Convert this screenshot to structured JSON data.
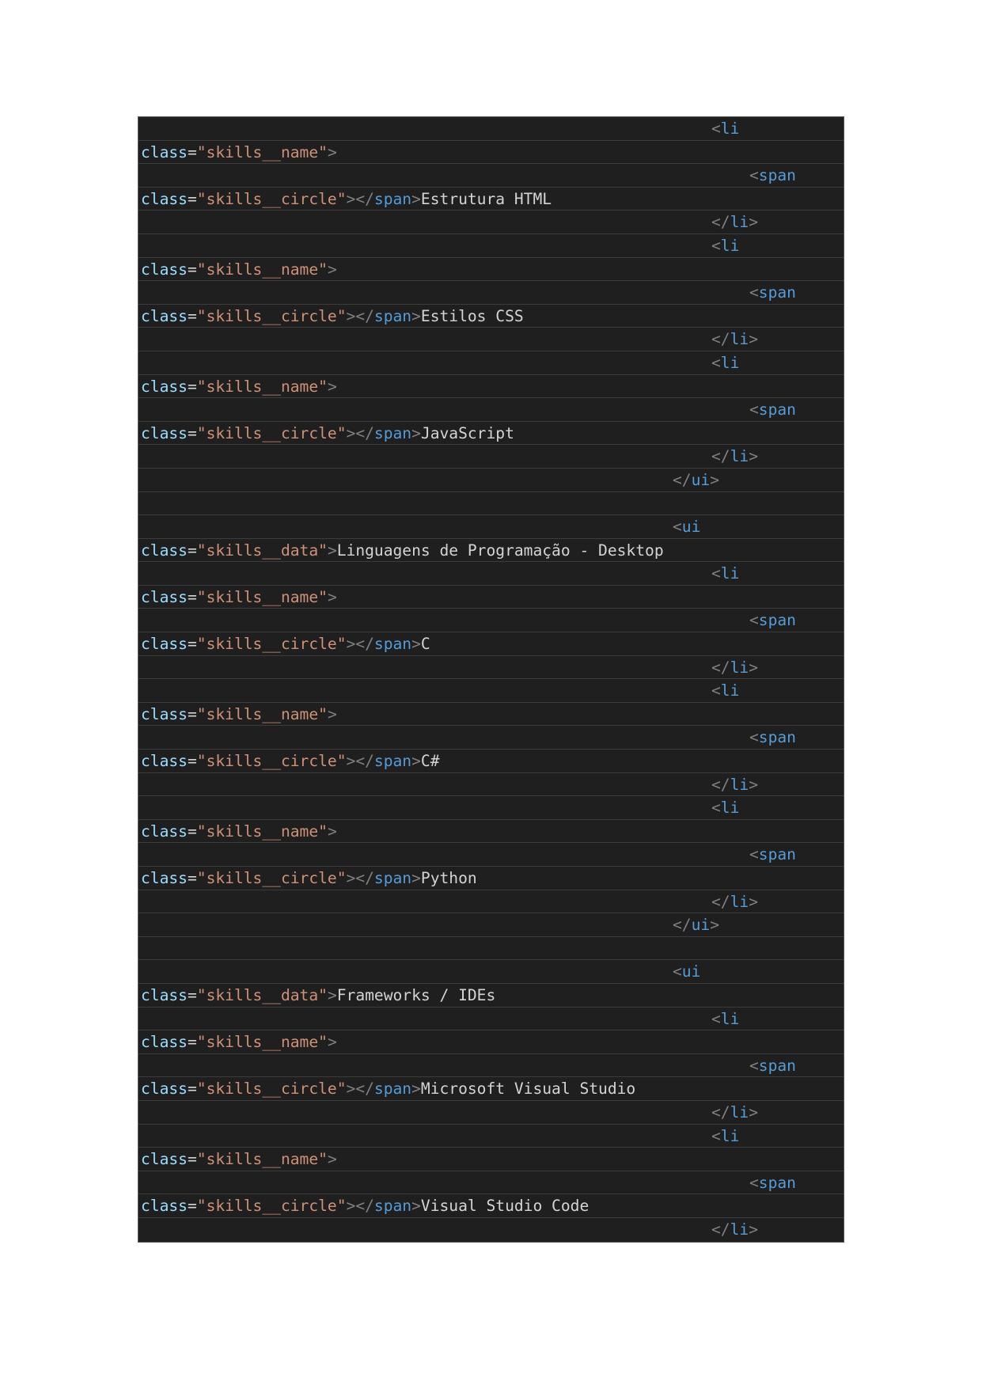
{
  "colors": {
    "background": "#1f1f1f",
    "attribute": "#9cdcfe",
    "string": "#ce9178",
    "punctuation": "#808080",
    "tag": "#569cd6",
    "text": "#d4d4d4"
  },
  "lines": [
    {
      "indent": "li",
      "tokens": [
        {
          "c": "punc",
          "t": "<"
        },
        {
          "c": "tag",
          "t": "li"
        }
      ]
    },
    {
      "indent": "none",
      "tokens": [
        {
          "c": "attr",
          "t": "class"
        },
        {
          "c": "eq",
          "t": "="
        },
        {
          "c": "str",
          "t": "\"skills__name\""
        },
        {
          "c": "punc",
          "t": ">"
        }
      ]
    },
    {
      "indent": "span",
      "tokens": [
        {
          "c": "punc",
          "t": "<"
        },
        {
          "c": "tag",
          "t": "span"
        }
      ]
    },
    {
      "indent": "none",
      "tokens": [
        {
          "c": "attr",
          "t": "class"
        },
        {
          "c": "eq",
          "t": "="
        },
        {
          "c": "str",
          "t": "\"skills__circle\""
        },
        {
          "c": "punc",
          "t": "></"
        },
        {
          "c": "tag",
          "t": "span"
        },
        {
          "c": "punc",
          "t": ">"
        },
        {
          "c": "text",
          "t": "Estrutura HTML"
        }
      ]
    },
    {
      "indent": "li",
      "tokens": [
        {
          "c": "punc",
          "t": "</"
        },
        {
          "c": "tag",
          "t": "li"
        },
        {
          "c": "punc",
          "t": ">"
        }
      ]
    },
    {
      "indent": "li",
      "tokens": [
        {
          "c": "punc",
          "t": "<"
        },
        {
          "c": "tag",
          "t": "li"
        }
      ]
    },
    {
      "indent": "none",
      "tokens": [
        {
          "c": "attr",
          "t": "class"
        },
        {
          "c": "eq",
          "t": "="
        },
        {
          "c": "str",
          "t": "\"skills__name\""
        },
        {
          "c": "punc",
          "t": ">"
        }
      ]
    },
    {
      "indent": "span",
      "tokens": [
        {
          "c": "punc",
          "t": "<"
        },
        {
          "c": "tag",
          "t": "span"
        }
      ]
    },
    {
      "indent": "none",
      "tokens": [
        {
          "c": "attr",
          "t": "class"
        },
        {
          "c": "eq",
          "t": "="
        },
        {
          "c": "str",
          "t": "\"skills__circle\""
        },
        {
          "c": "punc",
          "t": "></"
        },
        {
          "c": "tag",
          "t": "span"
        },
        {
          "c": "punc",
          "t": ">"
        },
        {
          "c": "text",
          "t": "Estilos CSS"
        }
      ]
    },
    {
      "indent": "li",
      "tokens": [
        {
          "c": "punc",
          "t": "</"
        },
        {
          "c": "tag",
          "t": "li"
        },
        {
          "c": "punc",
          "t": ">"
        }
      ]
    },
    {
      "indent": "li",
      "tokens": [
        {
          "c": "punc",
          "t": "<"
        },
        {
          "c": "tag",
          "t": "li"
        }
      ]
    },
    {
      "indent": "none",
      "tokens": [
        {
          "c": "attr",
          "t": "class"
        },
        {
          "c": "eq",
          "t": "="
        },
        {
          "c": "str",
          "t": "\"skills__name\""
        },
        {
          "c": "punc",
          "t": ">"
        }
      ]
    },
    {
      "indent": "span",
      "tokens": [
        {
          "c": "punc",
          "t": "<"
        },
        {
          "c": "tag",
          "t": "span"
        }
      ]
    },
    {
      "indent": "none",
      "tokens": [
        {
          "c": "attr",
          "t": "class"
        },
        {
          "c": "eq",
          "t": "="
        },
        {
          "c": "str",
          "t": "\"skills__circle\""
        },
        {
          "c": "punc",
          "t": "></"
        },
        {
          "c": "tag",
          "t": "span"
        },
        {
          "c": "punc",
          "t": ">"
        },
        {
          "c": "text",
          "t": "JavaScript"
        }
      ]
    },
    {
      "indent": "li",
      "tokens": [
        {
          "c": "punc",
          "t": "</"
        },
        {
          "c": "tag",
          "t": "li"
        },
        {
          "c": "punc",
          "t": ">"
        }
      ]
    },
    {
      "indent": "ui",
      "tokens": [
        {
          "c": "punc",
          "t": "</"
        },
        {
          "c": "tag",
          "t": "ui"
        },
        {
          "c": "punc",
          "t": ">"
        }
      ]
    },
    {
      "indent": "none",
      "tokens": []
    },
    {
      "indent": "ui",
      "tokens": [
        {
          "c": "punc",
          "t": "<"
        },
        {
          "c": "tag",
          "t": "ui"
        }
      ]
    },
    {
      "indent": "none",
      "tokens": [
        {
          "c": "attr",
          "t": "class"
        },
        {
          "c": "eq",
          "t": "="
        },
        {
          "c": "str",
          "t": "\"skills__data\""
        },
        {
          "c": "punc",
          "t": ">"
        },
        {
          "c": "text",
          "t": "Linguagens de Programação - Desktop"
        }
      ]
    },
    {
      "indent": "li",
      "tokens": [
        {
          "c": "punc",
          "t": "<"
        },
        {
          "c": "tag",
          "t": "li"
        }
      ]
    },
    {
      "indent": "none",
      "tokens": [
        {
          "c": "attr",
          "t": "class"
        },
        {
          "c": "eq",
          "t": "="
        },
        {
          "c": "str",
          "t": "\"skills__name\""
        },
        {
          "c": "punc",
          "t": ">"
        }
      ]
    },
    {
      "indent": "span",
      "tokens": [
        {
          "c": "punc",
          "t": "<"
        },
        {
          "c": "tag",
          "t": "span"
        }
      ]
    },
    {
      "indent": "none",
      "tokens": [
        {
          "c": "attr",
          "t": "class"
        },
        {
          "c": "eq",
          "t": "="
        },
        {
          "c": "str",
          "t": "\"skills__circle\""
        },
        {
          "c": "punc",
          "t": "></"
        },
        {
          "c": "tag",
          "t": "span"
        },
        {
          "c": "punc",
          "t": ">"
        },
        {
          "c": "text",
          "t": "C"
        }
      ]
    },
    {
      "indent": "li",
      "tokens": [
        {
          "c": "punc",
          "t": "</"
        },
        {
          "c": "tag",
          "t": "li"
        },
        {
          "c": "punc",
          "t": ">"
        }
      ]
    },
    {
      "indent": "li",
      "tokens": [
        {
          "c": "punc",
          "t": "<"
        },
        {
          "c": "tag",
          "t": "li"
        }
      ]
    },
    {
      "indent": "none",
      "tokens": [
        {
          "c": "attr",
          "t": "class"
        },
        {
          "c": "eq",
          "t": "="
        },
        {
          "c": "str",
          "t": "\"skills__name\""
        },
        {
          "c": "punc",
          "t": ">"
        }
      ]
    },
    {
      "indent": "span",
      "tokens": [
        {
          "c": "punc",
          "t": "<"
        },
        {
          "c": "tag",
          "t": "span"
        }
      ]
    },
    {
      "indent": "none",
      "tokens": [
        {
          "c": "attr",
          "t": "class"
        },
        {
          "c": "eq",
          "t": "="
        },
        {
          "c": "str",
          "t": "\"skills__circle\""
        },
        {
          "c": "punc",
          "t": "></"
        },
        {
          "c": "tag",
          "t": "span"
        },
        {
          "c": "punc",
          "t": ">"
        },
        {
          "c": "text",
          "t": "C#"
        }
      ]
    },
    {
      "indent": "li",
      "tokens": [
        {
          "c": "punc",
          "t": "</"
        },
        {
          "c": "tag",
          "t": "li"
        },
        {
          "c": "punc",
          "t": ">"
        }
      ]
    },
    {
      "indent": "li",
      "tokens": [
        {
          "c": "punc",
          "t": "<"
        },
        {
          "c": "tag",
          "t": "li"
        }
      ]
    },
    {
      "indent": "none",
      "tokens": [
        {
          "c": "attr",
          "t": "class"
        },
        {
          "c": "eq",
          "t": "="
        },
        {
          "c": "str",
          "t": "\"skills__name\""
        },
        {
          "c": "punc",
          "t": ">"
        }
      ]
    },
    {
      "indent": "span",
      "tokens": [
        {
          "c": "punc",
          "t": "<"
        },
        {
          "c": "tag",
          "t": "span"
        }
      ]
    },
    {
      "indent": "none",
      "tokens": [
        {
          "c": "attr",
          "t": "class"
        },
        {
          "c": "eq",
          "t": "="
        },
        {
          "c": "str",
          "t": "\"skills__circle\""
        },
        {
          "c": "punc",
          "t": "></"
        },
        {
          "c": "tag",
          "t": "span"
        },
        {
          "c": "punc",
          "t": ">"
        },
        {
          "c": "text",
          "t": "Python"
        }
      ]
    },
    {
      "indent": "li",
      "tokens": [
        {
          "c": "punc",
          "t": "</"
        },
        {
          "c": "tag",
          "t": "li"
        },
        {
          "c": "punc",
          "t": ">"
        }
      ]
    },
    {
      "indent": "ui",
      "tokens": [
        {
          "c": "punc",
          "t": "</"
        },
        {
          "c": "tag",
          "t": "ui"
        },
        {
          "c": "punc",
          "t": ">"
        }
      ]
    },
    {
      "indent": "none",
      "tokens": []
    },
    {
      "indent": "ui",
      "tokens": [
        {
          "c": "punc",
          "t": "<"
        },
        {
          "c": "tag",
          "t": "ui"
        }
      ]
    },
    {
      "indent": "none",
      "tokens": [
        {
          "c": "attr",
          "t": "class"
        },
        {
          "c": "eq",
          "t": "="
        },
        {
          "c": "str",
          "t": "\"skills__data\""
        },
        {
          "c": "punc",
          "t": ">"
        },
        {
          "c": "text",
          "t": "Frameworks / IDEs"
        }
      ]
    },
    {
      "indent": "li",
      "tokens": [
        {
          "c": "punc",
          "t": "<"
        },
        {
          "c": "tag",
          "t": "li"
        }
      ]
    },
    {
      "indent": "none",
      "tokens": [
        {
          "c": "attr",
          "t": "class"
        },
        {
          "c": "eq",
          "t": "="
        },
        {
          "c": "str",
          "t": "\"skills__name\""
        },
        {
          "c": "punc",
          "t": ">"
        }
      ]
    },
    {
      "indent": "span",
      "tokens": [
        {
          "c": "punc",
          "t": "<"
        },
        {
          "c": "tag",
          "t": "span"
        }
      ]
    },
    {
      "indent": "none",
      "tokens": [
        {
          "c": "attr",
          "t": "class"
        },
        {
          "c": "eq",
          "t": "="
        },
        {
          "c": "str",
          "t": "\"skills__circle\""
        },
        {
          "c": "punc",
          "t": "></"
        },
        {
          "c": "tag",
          "t": "span"
        },
        {
          "c": "punc",
          "t": ">"
        },
        {
          "c": "text",
          "t": "Microsoft Visual Studio"
        }
      ]
    },
    {
      "indent": "li",
      "tokens": [
        {
          "c": "punc",
          "t": "</"
        },
        {
          "c": "tag",
          "t": "li"
        },
        {
          "c": "punc",
          "t": ">"
        }
      ]
    },
    {
      "indent": "li",
      "tokens": [
        {
          "c": "punc",
          "t": "<"
        },
        {
          "c": "tag",
          "t": "li"
        }
      ]
    },
    {
      "indent": "none",
      "tokens": [
        {
          "c": "attr",
          "t": "class"
        },
        {
          "c": "eq",
          "t": "="
        },
        {
          "c": "str",
          "t": "\"skills__name\""
        },
        {
          "c": "punc",
          "t": ">"
        }
      ]
    },
    {
      "indent": "span",
      "tokens": [
        {
          "c": "punc",
          "t": "<"
        },
        {
          "c": "tag",
          "t": "span"
        }
      ]
    },
    {
      "indent": "none",
      "tokens": [
        {
          "c": "attr",
          "t": "class"
        },
        {
          "c": "eq",
          "t": "="
        },
        {
          "c": "str",
          "t": "\"skills__circle\""
        },
        {
          "c": "punc",
          "t": "></"
        },
        {
          "c": "tag",
          "t": "span"
        },
        {
          "c": "punc",
          "t": ">"
        },
        {
          "c": "text",
          "t": "Visual Studio Code"
        }
      ]
    },
    {
      "indent": "li",
      "tokens": [
        {
          "c": "punc",
          "t": "</"
        },
        {
          "c": "tag",
          "t": "li"
        },
        {
          "c": "punc",
          "t": ">"
        }
      ]
    }
  ]
}
